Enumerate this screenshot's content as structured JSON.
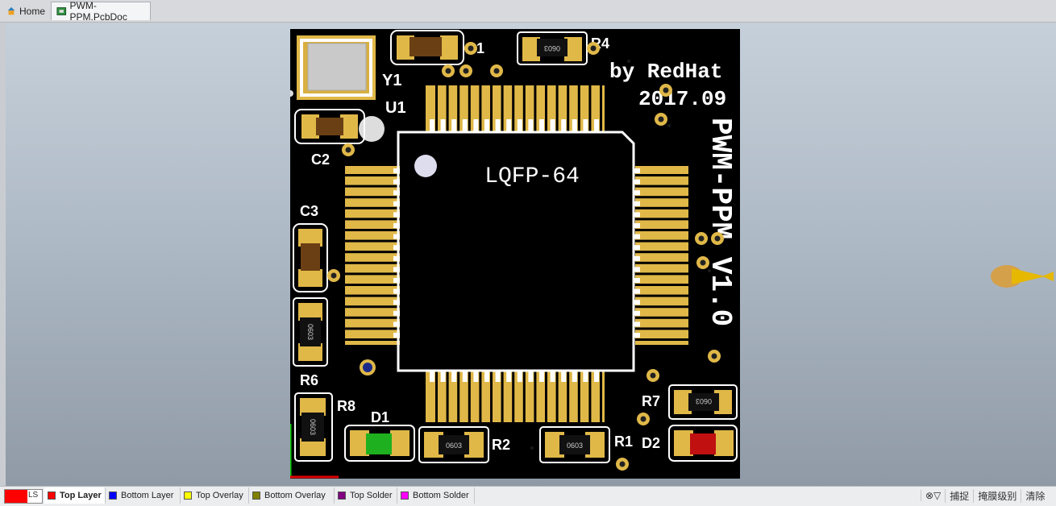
{
  "tabs": [
    {
      "label": "Home"
    },
    {
      "label": "PWM-PPM.PcbDoc"
    }
  ],
  "board": {
    "chip_label": "LQFP-64",
    "credit_line1": "by RedHat",
    "credit_line2": "2017.09",
    "vertical_title": "PWM-PPM V1.0",
    "designators": {
      "y1": "Y1",
      "u1": "U1",
      "c1": "C1",
      "c2": "C2",
      "c3": "C3",
      "r4": "R4",
      "r6": "R6",
      "r8": "R8",
      "d1": "D1",
      "r2": "R2",
      "r1": "R1",
      "d2": "D2",
      "r7": "R7"
    },
    "package_label": "0603"
  },
  "layerbar": {
    "current_swatch": "LS",
    "layers": [
      {
        "label": "Top Layer",
        "color": "#ff0000"
      },
      {
        "label": "Bottom Layer",
        "color": "#0000ff"
      },
      {
        "label": "Top Overlay",
        "color": "#ffff00"
      },
      {
        "label": "Bottom Overlay",
        "color": "#808000"
      },
      {
        "label": "Top Solder",
        "color": "#800080"
      },
      {
        "label": "Bottom Solder",
        "color": "#ff00ff"
      }
    ],
    "right_tools": {
      "filter_glyph": "⊗▽",
      "snap": "捕捉",
      "mask": "掩膜级别",
      "clear": "清除"
    }
  }
}
